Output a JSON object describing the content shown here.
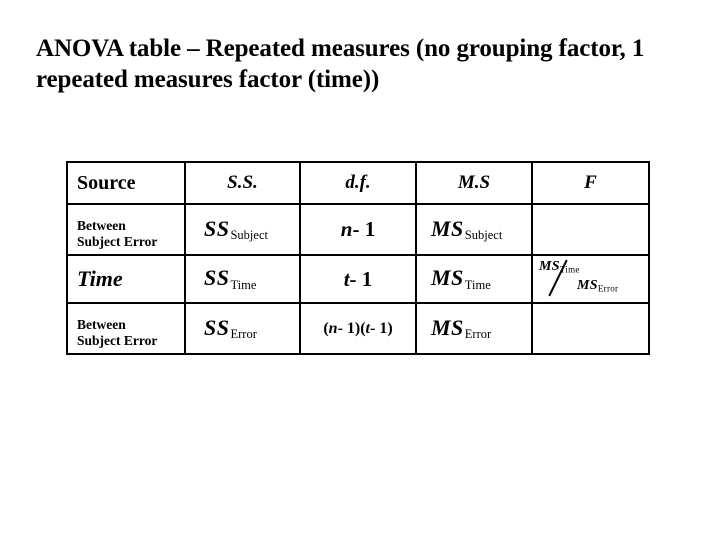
{
  "title": "ANOVA table – Repeated measures (no grouping factor, 1 repeated measures factor (time))",
  "table": {
    "headers": {
      "source": "Source",
      "ss": "S.S.",
      "df": "d.f.",
      "ms": "M.S",
      "f": "F"
    },
    "rows": [
      {
        "source_line1": "Between",
        "source_line2": "Subject Error",
        "ss_base": "SS",
        "ss_sub": "Subject",
        "df": "n - 1",
        "df_var": "n",
        "df_rest": " - 1",
        "ms_base": "MS",
        "ms_sub": "Subject",
        "f": ""
      },
      {
        "source_line1": "Time",
        "source_line2": "",
        "ss_base": "SS",
        "ss_sub": "Time",
        "df": "t - 1",
        "df_var": "t",
        "df_rest": " - 1",
        "ms_base": "MS",
        "ms_sub": "Time",
        "f_numerator_base": "MS",
        "f_numerator_sub": "Time",
        "f_denominator_base": "MS",
        "f_denominator_sub": "Error"
      },
      {
        "source_line1": "Between",
        "source_line2": "Subject Error",
        "ss_base": "SS",
        "ss_sub": "Error",
        "df": "(n - 1)(t - 1)",
        "df_open1": "(",
        "df_var1": "n",
        "df_mid": " - 1)(",
        "df_var2": "t",
        "df_close": " - 1)",
        "ms_base": "MS",
        "ms_sub": "Error",
        "f": ""
      }
    ]
  },
  "colors": {
    "text": "#000000",
    "background": "#ffffff",
    "border": "#000000"
  }
}
